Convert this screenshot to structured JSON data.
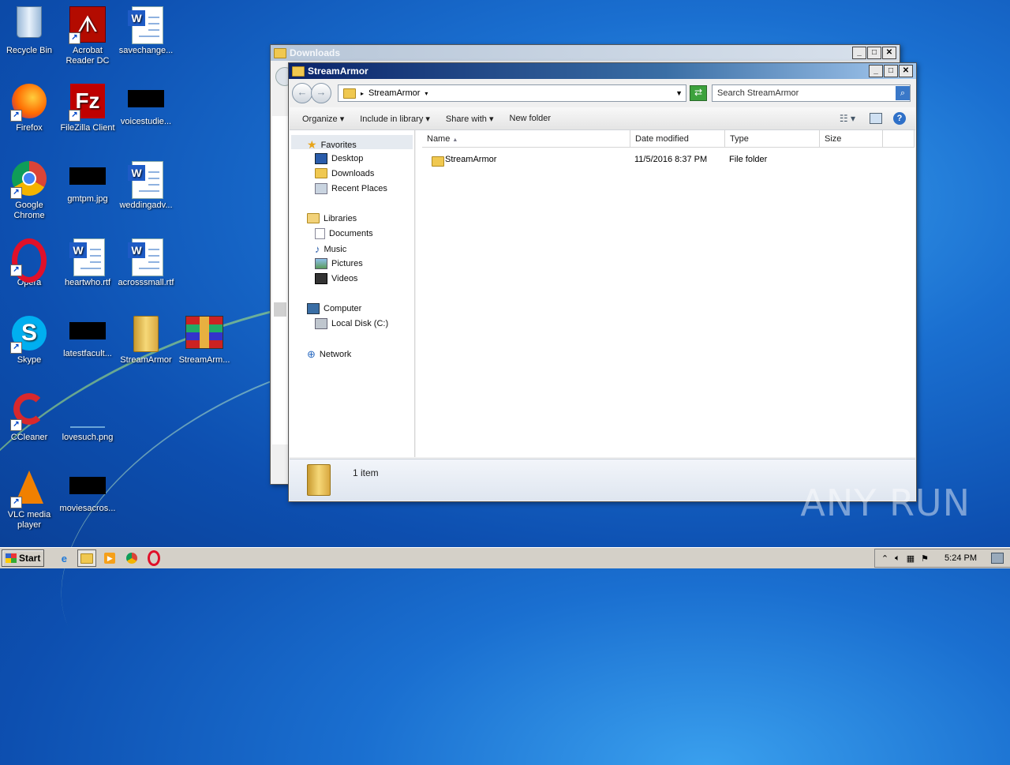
{
  "desktop": {
    "icons": [
      {
        "label": "Recycle Bin"
      },
      {
        "label": "Acrobat Reader DC"
      },
      {
        "label": "savechange..."
      },
      {
        "label": "Firefox"
      },
      {
        "label": "FileZilla Client"
      },
      {
        "label": "voicestudie..."
      },
      {
        "label": "Google Chrome"
      },
      {
        "label": "gmtpm.jpg"
      },
      {
        "label": "weddingadv..."
      },
      {
        "label": "Opera"
      },
      {
        "label": "heartwho.rtf"
      },
      {
        "label": "acrosssmall.rtf"
      },
      {
        "label": "Skype"
      },
      {
        "label": "latestfacult..."
      },
      {
        "label": "StreamArmor"
      },
      {
        "label": "StreamArm..."
      },
      {
        "label": "CCleaner"
      },
      {
        "label": "lovesuch.png"
      },
      {
        "label": "VLC media player"
      },
      {
        "label": "moviesacros..."
      }
    ]
  },
  "back_window": {
    "title": "Downloads"
  },
  "explorer": {
    "title": "StreamArmor",
    "address": "StreamArmor",
    "search_placeholder": "Search StreamArmor",
    "toolbar": {
      "organize": "Organize",
      "include": "Include in library",
      "share": "Share with",
      "new_folder": "New folder"
    },
    "nav": {
      "favorites": "Favorites",
      "desktop": "Desktop",
      "downloads": "Downloads",
      "recent": "Recent Places",
      "libraries": "Libraries",
      "documents": "Documents",
      "music": "Music",
      "pictures": "Pictures",
      "videos": "Videos",
      "computer": "Computer",
      "local_disk": "Local Disk (C:)",
      "network": "Network"
    },
    "columns": {
      "name": "Name",
      "date": "Date modified",
      "type": "Type",
      "size": "Size"
    },
    "files": [
      {
        "name": "StreamArmor",
        "date": "11/5/2016 8:37 PM",
        "type": "File folder",
        "size": ""
      }
    ],
    "status": "1 item"
  },
  "taskbar": {
    "start": "Start",
    "clock": "5:24 PM"
  },
  "watermark": "ANY RUN"
}
